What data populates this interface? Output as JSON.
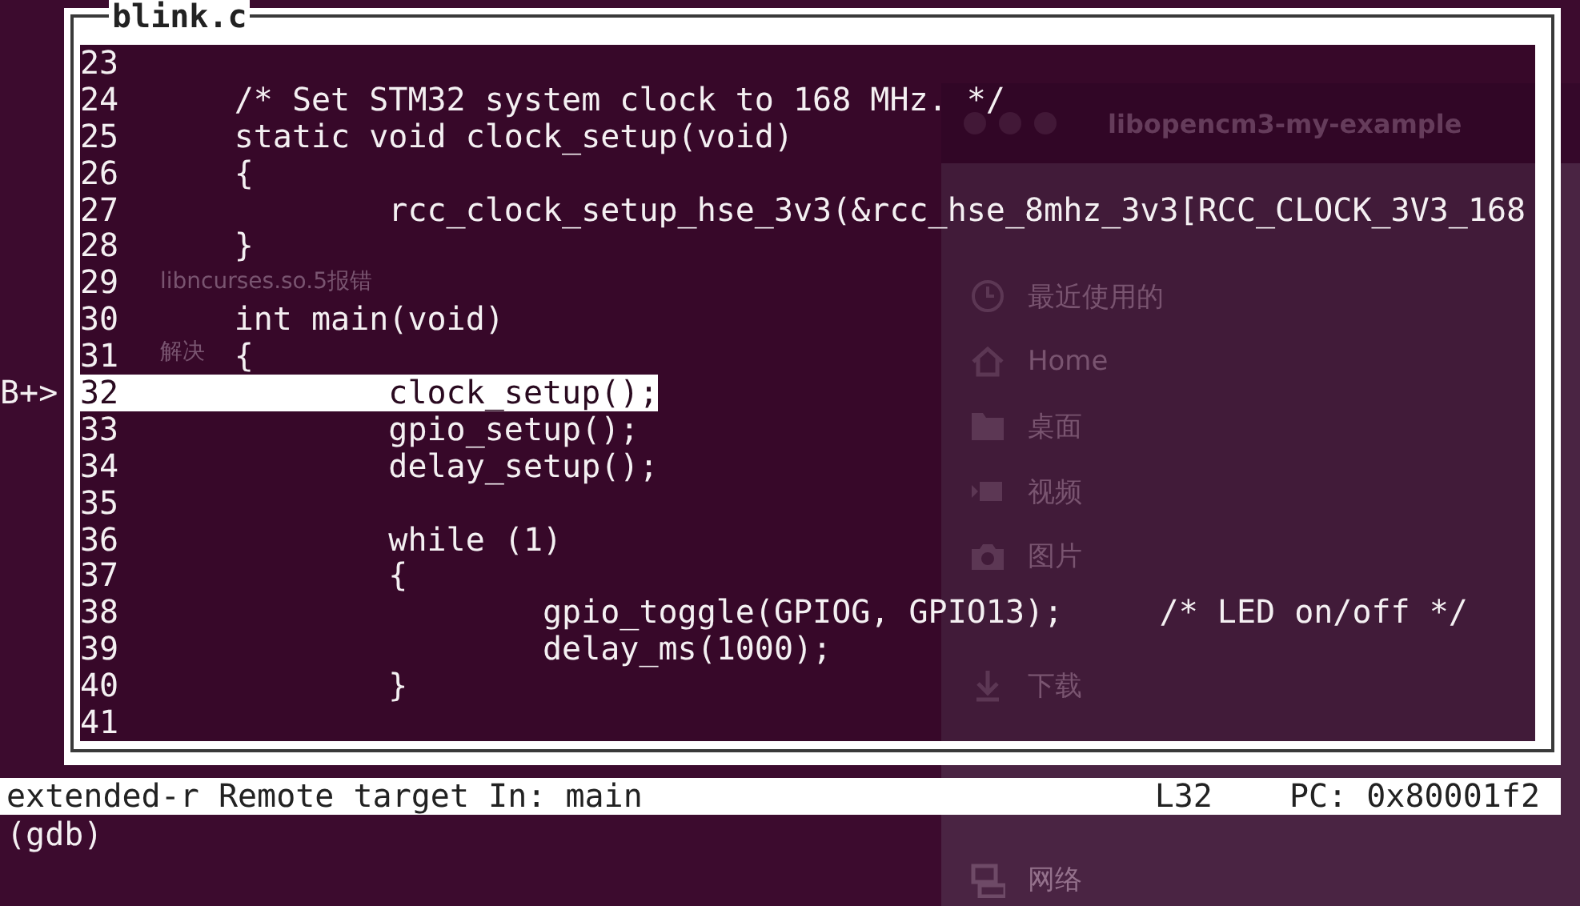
{
  "desktop": {
    "icon_label": [
      "libncurses.so.5报错",
      "解决"
    ]
  },
  "file_manager": {
    "title": "libopencm3-my-example",
    "place_groups": [
      {
        "items": [
          "最近使用的",
          "Home",
          "桌面",
          "视频",
          "图片"
        ]
      },
      {
        "items": [
          "下载"
        ]
      },
      {
        "items": [
          "网络"
        ]
      }
    ]
  },
  "source_window": {
    "title": "blink.c",
    "lines": [
      {
        "number": "23",
        "current": false
      },
      {
        "number": "24",
        "code": "/* Set STM32 system clock to 168 MHz. */",
        "current": false
      },
      {
        "number": "25",
        "code": "static void clock_setup(void)",
        "current": false
      },
      {
        "number": "26",
        "code": "{",
        "current": false
      },
      {
        "number": "27",
        "code": "        rcc_clock_setup_hse_3v3(&rcc_hse_8mhz_3v3[RCC_CLOCK_3V3_168",
        "current": false
      },
      {
        "number": "28",
        "code": "}",
        "current": false
      },
      {
        "number": "29",
        "current": false
      },
      {
        "number": "30",
        "code": "int main(void)",
        "current": false
      },
      {
        "number": "31",
        "code": "{",
        "current": false
      },
      {
        "number": "32",
        "code": "        clock_setup();",
        "current": true,
        "marker": "B+>"
      },
      {
        "number": "33",
        "code": "        gpio_setup();",
        "current": false
      },
      {
        "number": "34",
        "code": "        delay_setup();",
        "current": false
      },
      {
        "number": "35",
        "current": false
      },
      {
        "number": "36",
        "code": "        while (1)",
        "current": false
      },
      {
        "number": "37",
        "code": "        {",
        "current": false
      },
      {
        "number": "38",
        "code": "                gpio_toggle(GPIOG, GPIO13);     /* LED on/off */",
        "current": false
      },
      {
        "number": "39",
        "code": "                delay_ms(1000);",
        "current": false
      },
      {
        "number": "40",
        "code": "        }",
        "current": false
      },
      {
        "number": "41",
        "current": false
      }
    ]
  },
  "status_bar": {
    "target": "extended-r Remote target In: main",
    "line": "L32",
    "pc": "PC: 0x80001f2"
  },
  "prompt": "(gdb)"
}
